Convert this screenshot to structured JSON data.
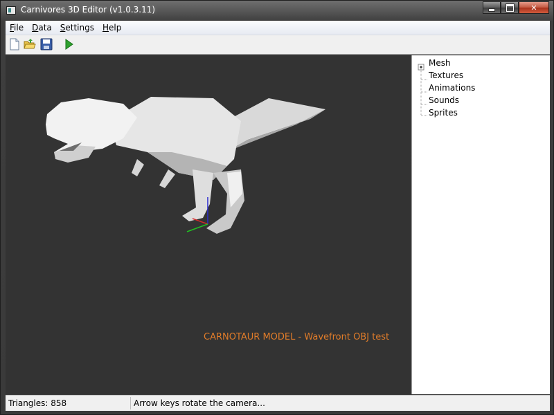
{
  "window": {
    "title": "Carnivores 3D Editor (v1.0.3.11)"
  },
  "menu": [
    {
      "mnemonic": "F",
      "rest": "ile"
    },
    {
      "mnemonic": "D",
      "rest": "ata"
    },
    {
      "mnemonic": "S",
      "rest": "ettings"
    },
    {
      "mnemonic": "H",
      "rest": "elp"
    }
  ],
  "toolbar": {
    "icons": [
      "new-file-icon",
      "open-folder-icon",
      "save-disk-icon",
      "play-icon"
    ]
  },
  "viewport": {
    "overlay_text": "CARNOTAUR MODEL - Wavefront OBJ test",
    "overlay_color": "#e07c2a",
    "background_color": "#333333"
  },
  "tree": {
    "items": [
      "Mesh",
      "Textures",
      "Animations",
      "Sounds",
      "Sprites"
    ],
    "expandable_item": "Mesh"
  },
  "status": {
    "left": "Triangles: 858",
    "right": "Arrow keys rotate the camera..."
  }
}
